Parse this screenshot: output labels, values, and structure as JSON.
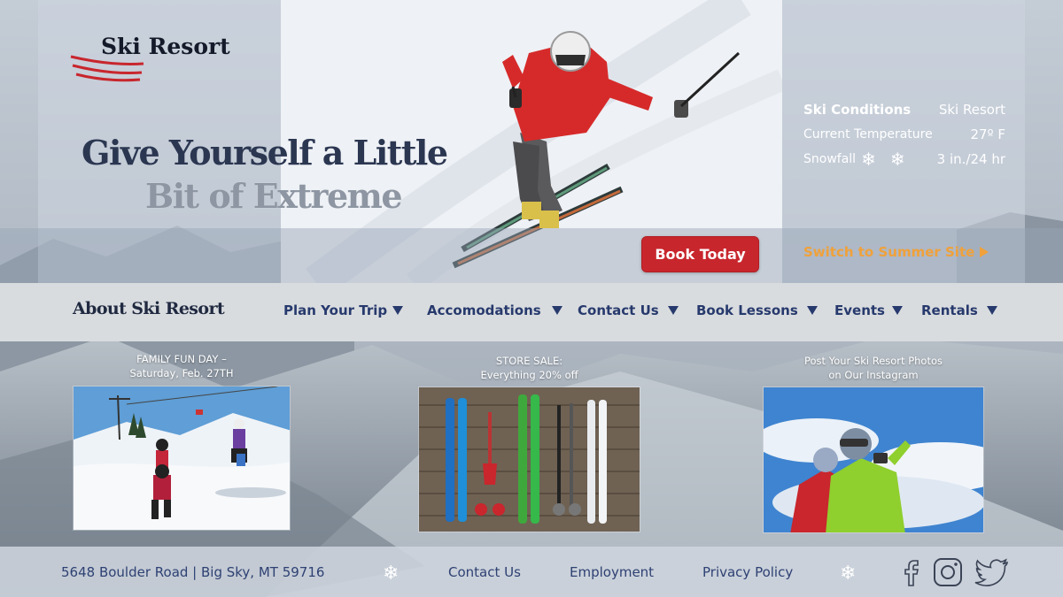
{
  "brand": {
    "name": "Ski Resort"
  },
  "hero": {
    "headline_line1": "Give Yourself a Little",
    "headline_line2": "Bit of Extreme"
  },
  "conditions": {
    "title": "Ski Conditions",
    "location": "Ski Resort",
    "temperature_label": "Current Temperature",
    "temperature_value": "27º F",
    "snowfall_label": "Snowfall",
    "snowfall_value": "3 in./24 hr"
  },
  "cta": {
    "book_label": "Book Today",
    "summer_label": "Switch to Summer Site"
  },
  "nav": {
    "about": "About Ski Resort",
    "items": [
      {
        "label": "Plan Your Trip"
      },
      {
        "label": "Accomodations"
      },
      {
        "label": "Contact Us"
      },
      {
        "label": "Book Lessons"
      },
      {
        "label": "Events"
      },
      {
        "label": "Rentals"
      }
    ]
  },
  "promos": [
    {
      "line1": "FAMILY FUN DAY –",
      "line2": "Saturday, Feb. 27TH"
    },
    {
      "line1": "STORE SALE:",
      "line2": "Everything 20% off"
    },
    {
      "line1": "Post Your Ski Resort Photos",
      "line2": "on Our Instagram"
    }
  ],
  "footer": {
    "address": "5648 Boulder Road | Big Sky, MT 59716",
    "contact": "Contact Us",
    "employment": "Employment",
    "privacy": "Privacy Policy"
  },
  "icons": {
    "snowflake": "snowflake-icon",
    "facebook": "facebook-icon",
    "instagram": "instagram-icon",
    "twitter": "twitter-icon"
  },
  "colors": {
    "accent_red": "#c8262d",
    "accent_orange": "#f0a13a",
    "nav_text": "#273a6d",
    "headline": "#2b3651"
  }
}
